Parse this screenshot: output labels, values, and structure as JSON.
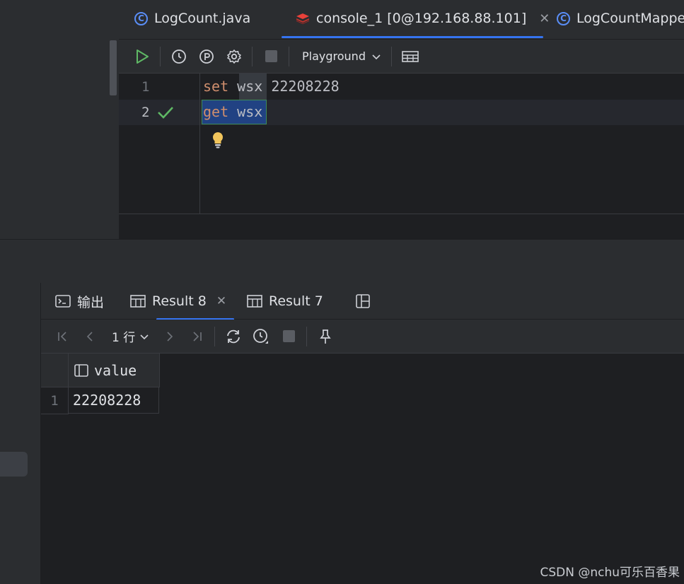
{
  "editor_tabs": [
    {
      "label": "LogCount.java",
      "icon": "class-c-icon"
    },
    {
      "label": "console_1 [0@192.168.88.101]",
      "icon": "redis-icon",
      "active": true
    },
    {
      "label": "LogCountMappe",
      "icon": "class-c-icon"
    }
  ],
  "toolbar": {
    "schema_label": "Playground"
  },
  "code_lines": [
    {
      "num": "1",
      "keyword": "set",
      "text": " wsx 22208228"
    },
    {
      "num": "2",
      "keyword": "get",
      "text": " wsx"
    }
  ],
  "results": {
    "tabs": [
      {
        "label": "输出",
        "icon": "terminal-icon"
      },
      {
        "label": "Result 8",
        "icon": "table-icon",
        "active": true
      },
      {
        "label": "Result 7",
        "icon": "table-icon"
      }
    ],
    "row_count_label": "1 行",
    "columns": [
      "value"
    ],
    "rows": [
      {
        "num": "1",
        "cells": [
          "22208228"
        ]
      }
    ]
  },
  "watermark": "CSDN @nchu可乐百香果",
  "colors": {
    "accent": "#3574f0",
    "keyword": "#cf8e6d",
    "success": "#5fb865"
  }
}
